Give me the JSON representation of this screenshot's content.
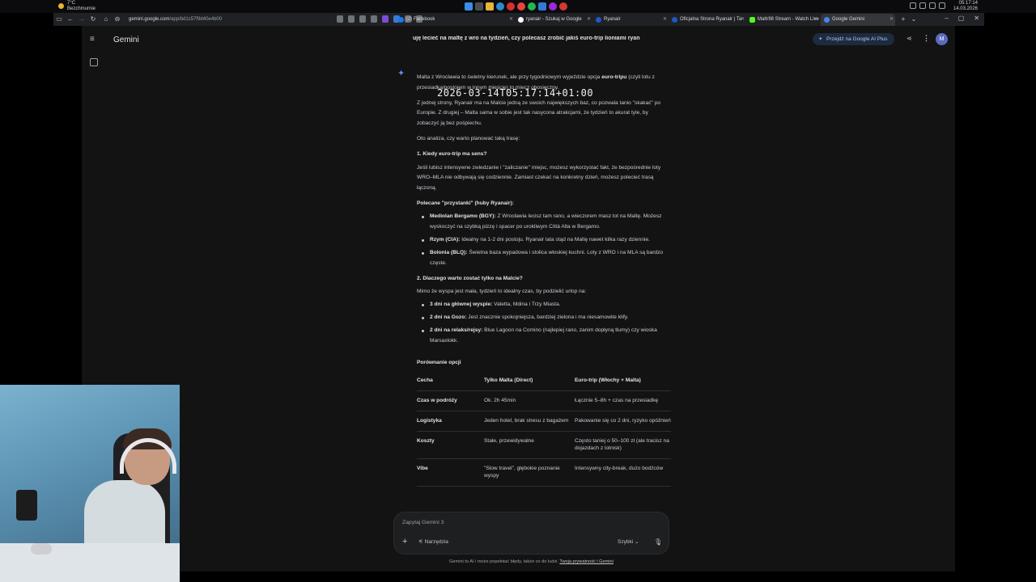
{
  "taskbar": {
    "weather_temp": "7°C",
    "weather_desc": "Bezchmurnie",
    "clock_time": "05:17:14",
    "clock_date": "14.03.2026"
  },
  "browser": {
    "url_domain": "gemini.google.com",
    "url_path": "/app/bd1c57f9d40e4b00",
    "tabs": [
      {
        "label": "(2) Facebook",
        "color": "#1877f2"
      },
      {
        "label": "ryanair - Szukaj w Google",
        "color": "#ffffff"
      },
      {
        "label": "Ryanair",
        "color": "#073590"
      },
      {
        "label": "Oficjalna Strona Ryanair | Ta",
        "color": "#073590"
      },
      {
        "label": "Maltr98 Stream - Watch Live",
        "color": "#53fc18"
      },
      {
        "label": "Google Gemini",
        "color": "#4285f4"
      }
    ]
  },
  "header": {
    "app_title": "Gemini",
    "conversation_title": "uję lecieć na maltę z wro na tydzień, czy polecasz zrobić jakiś euro-trip lioniami ryan",
    "upgrade_label": "Przejdź na Google AI Plus",
    "avatar_letter": "M"
  },
  "overlay": {
    "timestamp": "2026-03-14T05:17:14+01:00"
  },
  "response": {
    "intro_1": "Malta z Wrocławia to świetny kierunek, ale przy tygodniowym wyjeździe opcja",
    "intro_1_bold": "euro-tripu",
    "intro_1_rest": "(czyli lotu z przesiadką/postojem w innym mieście) to miecz obosieczny.",
    "intro_2": "Z jednej strony, Ryanair ma na Malcie jedną ze swoich największych baz, co pozwala tanio \"skakać\" po Europie. Z drugiej – Malta sama w sobie jest tak nasycona atrakcjami, że tydzień to akurat tyle, by zobaczyć ją bez pośpiechu.",
    "intro_3": "Oto analiza, czy warto planować taką trasę:",
    "section_1_title": "1. Kiedy euro-trip ma sens?",
    "section_1_text": "Jeśli lubisz intensywne zwiedzanie i \"zaliczanie\" miejsc, możesz wykorzystać fakt, że bezpośrednie loty WRO–MLA nie odbywają się codziennie. Zamiast czekać na konkretny dzień, możesz polecieć trasą łączoną.",
    "hubs_title": "Polecane \"przystanki\" (huby Ryanair):",
    "hubs": [
      {
        "name": "Mediolan Bergamo (BGY):",
        "text": "Z Wrocławia lecisz tam rano, a wieczorem masz lot na Maltę. Możesz wyskoczyć na szybką pizzę i spacer po urokliwym Città Alta w Bergamo."
      },
      {
        "name": "Rzym (CIA):",
        "text": "Idealny na 1-2 dni postoju. Ryanair lata stąd na Maltę nawet kilka razy dziennie."
      },
      {
        "name": "Bolonia (BLQ):",
        "text": "Świetna baza wypadowa i stolica włoskiej kuchni. Loty z WRO i na MLA są bardzo częste."
      }
    ],
    "section_2_title": "2. Dlaczego warto zostać tylko na Malcie?",
    "section_2_text": "Mimo że wyspa jest mała, tydzień to idealny czas, by podzielić urlop na:",
    "plan": [
      {
        "name": "3 dni na głównej wyspie:",
        "text": "Valetta, Mdina i Trzy Miasta."
      },
      {
        "name": "2 dni na Gozo:",
        "text": "Jest znacznie spokojniejsza, bardziej zielona i ma niesamowite klify."
      },
      {
        "name": "2 dni na relaks/rejsy:",
        "text": "Blue Lagoon na Comino (najlepiej rano, zanim dopłyną tłumy) czy wioska Marsaxlokk."
      }
    ],
    "compare_title": "Porównanie opcji",
    "table": {
      "headers": [
        "Cecha",
        "Tylko Malta (Direct)",
        "Euro-trip (Włochy + Malta)"
      ],
      "rows": [
        [
          "Czas w podróży",
          "Ok. 2h 45min",
          "Łącznie 5–8h + czas na przesiadkę"
        ],
        [
          "Logistyka",
          "Jeden hotel, brak stresu z bagażem",
          "Pakowanie się co 2 dni, ryzyko opóźnień"
        ],
        [
          "Koszty",
          "Stałe, przewidywalne",
          "Często taniej o 50–100 zł (ale tracisz na dojazdach z lotnisk)"
        ],
        [
          "Vibe",
          "\"Slow travel\", głębokie poznanie wyspy",
          "Intensywny city-break, dużo bodźców"
        ]
      ]
    }
  },
  "composer": {
    "placeholder": "Zapytaj Gemini 3",
    "tools_label": "Narzędzia",
    "model_label": "Szybki"
  },
  "footer": {
    "disclaimer": "Gemini to AI i może popełniać błędy, także co do ludzi.",
    "privacy_link": "Twoja prywatność i Gemini"
  }
}
